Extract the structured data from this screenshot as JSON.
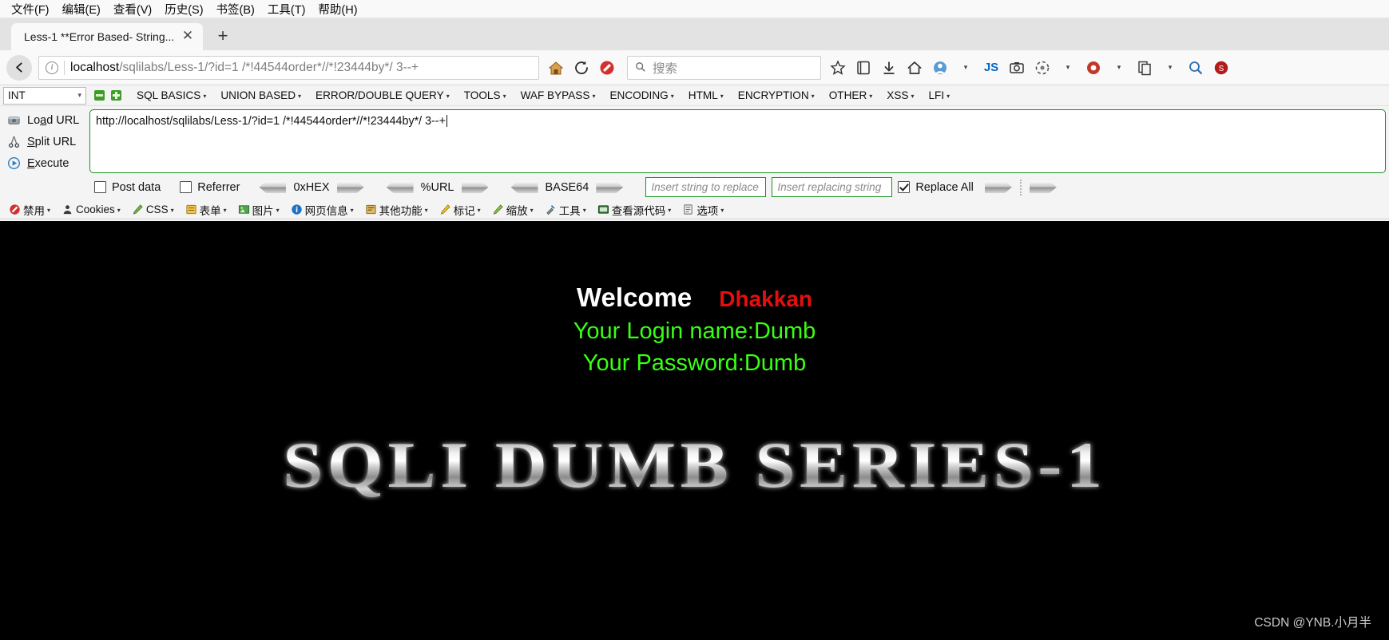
{
  "browser": {
    "menus": [
      {
        "label": "文件(F)"
      },
      {
        "label": "编辑(E)"
      },
      {
        "label": "查看(V)"
      },
      {
        "label": "历史(S)"
      },
      {
        "label": "书签(B)"
      },
      {
        "label": "工具(T)"
      },
      {
        "label": "帮助(H)"
      }
    ],
    "tab": {
      "title": "Less-1 **Error Based- String...",
      "close_label": "✕"
    },
    "newtab_label": "+",
    "nav": {
      "back_label": "←",
      "info_label": "i",
      "reload_label": "↻",
      "home_label": "⌂"
    },
    "url": {
      "host": "localhost",
      "path": "/sqlilabs/Less-1/?id=1 /*!44544order*//*!23444by*/ 3--+",
      "full": "localhost/sqlilabs/Less-1/?id=1 /*!44544order*//*!23444by*/ 3--+"
    },
    "search": {
      "placeholder": "搜索",
      "icon": "search-icon"
    },
    "toolbar_icons": [
      "star-icon",
      "library-icon",
      "download-icon",
      "home-icon",
      "account-icon",
      "js-icon",
      "screenshot-icon",
      "adblock-icon",
      "menu-caret-icon",
      "proxy-icon",
      "copy-icon",
      "caret-icon",
      "zoom-icon",
      "noscript-icon"
    ]
  },
  "hackbar": {
    "type_select": {
      "value": "INT",
      "chevron": "⌄"
    },
    "minus_label": "-",
    "plus_label": "+",
    "menus": [
      {
        "label": "SQL BASICS"
      },
      {
        "label": "UNION BASED"
      },
      {
        "label": "ERROR/DOUBLE QUERY"
      },
      {
        "label": "TOOLS"
      },
      {
        "label": "WAF BYPASS"
      },
      {
        "label": "ENCODING"
      },
      {
        "label": "HTML"
      },
      {
        "label": "ENCRYPTION"
      },
      {
        "label": "OTHER"
      },
      {
        "label": "XSS"
      },
      {
        "label": "LFI"
      }
    ],
    "caret": "▾",
    "actions": [
      {
        "label": "Load URL",
        "icon": "load-url-icon",
        "accesskey_pre": "Lo",
        "accesskey": "a",
        "accesskey_post": "d URL"
      },
      {
        "label": "Split URL",
        "icon": "split-url-icon",
        "accesskey_pre": "S",
        "accesskey": "p",
        "accesskey_post": "lit URL"
      },
      {
        "label": "Execute",
        "icon": "execute-icon",
        "accesskey_pre": "",
        "accesskey": "E",
        "accesskey_post": "xecute"
      }
    ],
    "request_value": "http://localhost/sqlilabs/Less-1/?id=1 /*!44544order*//*!23444by*/ 3--+",
    "options": {
      "post_data": {
        "label": "Post data",
        "checked": false
      },
      "referrer": {
        "label": "Referrer",
        "checked": false
      },
      "replace_all": {
        "label": "Replace All",
        "checked": true
      }
    },
    "encoders": [
      {
        "label": "0xHEX"
      },
      {
        "label": "%URL"
      },
      {
        "label": "BASE64"
      }
    ],
    "replace_inputs": [
      {
        "placeholder": "Insert string to replace"
      },
      {
        "placeholder": "Insert replacing string"
      }
    ]
  },
  "webdev": {
    "items": [
      {
        "label": "禁用",
        "icon": "disable-icon",
        "caret": true
      },
      {
        "label": "Cookies",
        "icon": "cookies-icon",
        "caret": true
      },
      {
        "label": "CSS",
        "icon": "css-icon",
        "caret": true
      },
      {
        "label": "表单",
        "icon": "forms-icon",
        "caret": true
      },
      {
        "label": "图片",
        "icon": "images-icon",
        "caret": true
      },
      {
        "label": "网页信息",
        "icon": "information-icon",
        "caret": true
      },
      {
        "label": "其他功能",
        "icon": "misc-icon",
        "caret": true
      },
      {
        "label": "标记",
        "icon": "outline-icon",
        "caret": true
      },
      {
        "label": "缩放",
        "icon": "resize-icon",
        "caret": true
      },
      {
        "label": "工具",
        "icon": "tools-icon",
        "caret": true
      },
      {
        "label": "查看源代码",
        "icon": "view-source-icon",
        "caret": true
      },
      {
        "label": "选项",
        "icon": "options-icon",
        "caret": true
      }
    ]
  },
  "page": {
    "welcome": "Welcome",
    "username_display": "Dhakkan",
    "login_name": "Your Login name:Dumb",
    "password": "Your Password:Dumb",
    "banner": "SQLI DUMB SERIES-1",
    "watermark": "CSDN @YNB.小月半",
    "colors": {
      "background": "#000000",
      "welcome": "#ffffff",
      "name": "#e50f0f",
      "green": "#39ff14"
    }
  }
}
